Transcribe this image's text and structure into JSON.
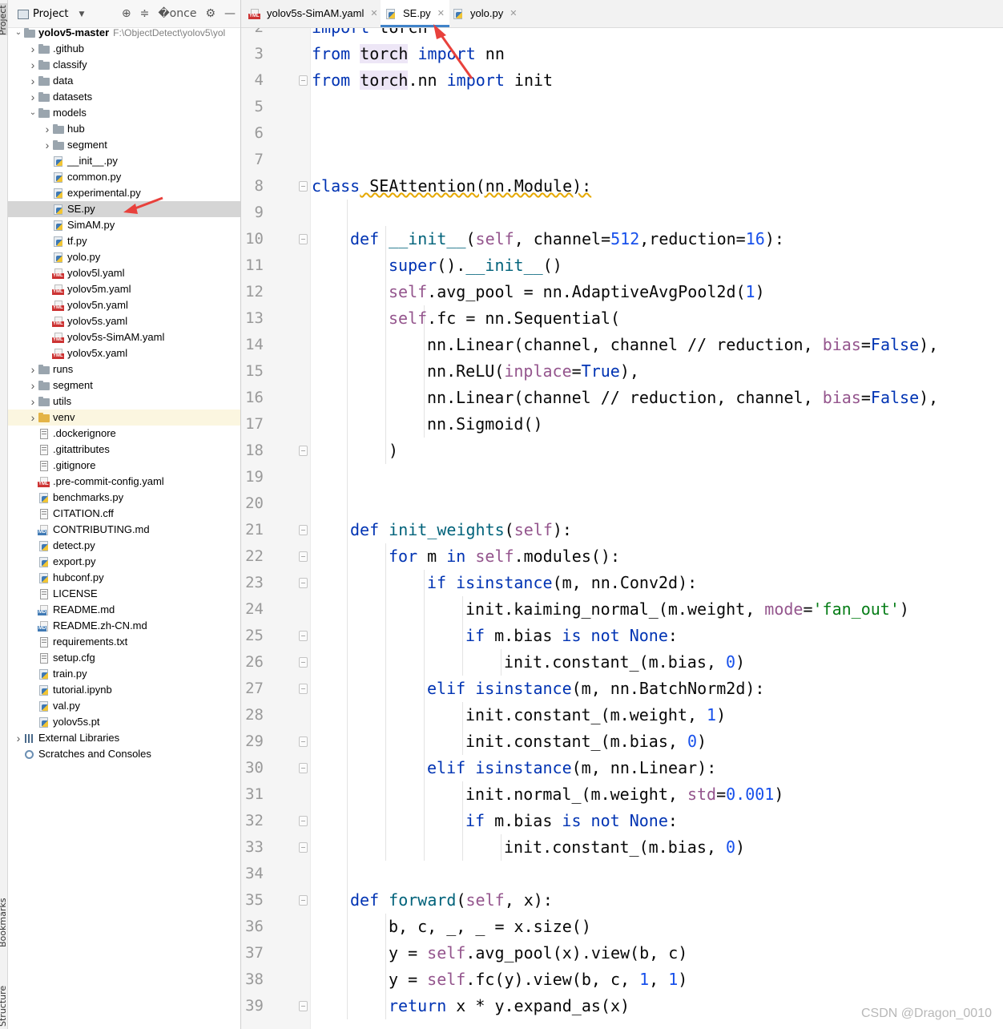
{
  "side_strip": {
    "project_label": "Project",
    "bookmarks_label": "Bookmarks",
    "structure_label": "Structure"
  },
  "project_panel": {
    "title": "Project"
  },
  "tree": [
    {
      "label": "yolov5-master",
      "path": "F:\\ObjectDetect\\yolov5\\yol",
      "type": "root",
      "depth": 0,
      "chev": "open"
    },
    {
      "label": ".github",
      "type": "folder",
      "depth": 1,
      "chev": "closed"
    },
    {
      "label": "classify",
      "type": "folder",
      "depth": 1,
      "chev": "closed"
    },
    {
      "label": "data",
      "type": "folder",
      "depth": 1,
      "chev": "closed"
    },
    {
      "label": "datasets",
      "type": "folder",
      "depth": 1,
      "chev": "closed"
    },
    {
      "label": "models",
      "type": "folder",
      "depth": 1,
      "chev": "open"
    },
    {
      "label": "hub",
      "type": "folder",
      "depth": 2,
      "chev": "closed"
    },
    {
      "label": "segment",
      "type": "folder",
      "depth": 2,
      "chev": "closed"
    },
    {
      "label": "__init__.py",
      "type": "py",
      "depth": 2
    },
    {
      "label": "common.py",
      "type": "py",
      "depth": 2
    },
    {
      "label": "experimental.py",
      "type": "py",
      "depth": 2
    },
    {
      "label": "SE.py",
      "type": "py",
      "depth": 2,
      "selected": true
    },
    {
      "label": "SimAM.py",
      "type": "py",
      "depth": 2
    },
    {
      "label": "tf.py",
      "type": "py",
      "depth": 2
    },
    {
      "label": "yolo.py",
      "type": "py",
      "depth": 2
    },
    {
      "label": "yolov5l.yaml",
      "type": "yml",
      "depth": 2
    },
    {
      "label": "yolov5m.yaml",
      "type": "yml",
      "depth": 2
    },
    {
      "label": "yolov5n.yaml",
      "type": "yml",
      "depth": 2
    },
    {
      "label": "yolov5s.yaml",
      "type": "yml",
      "depth": 2
    },
    {
      "label": "yolov5s-SimAM.yaml",
      "type": "yml",
      "depth": 2
    },
    {
      "label": "yolov5x.yaml",
      "type": "yml",
      "depth": 2
    },
    {
      "label": "runs",
      "type": "folder",
      "depth": 1,
      "chev": "closed"
    },
    {
      "label": "segment",
      "type": "folder",
      "depth": 1,
      "chev": "closed"
    },
    {
      "label": "utils",
      "type": "folder",
      "depth": 1,
      "chev": "closed"
    },
    {
      "label": "venv",
      "type": "folder-orange",
      "depth": 1,
      "chev": "closed",
      "excluded": true
    },
    {
      "label": ".dockerignore",
      "type": "txt",
      "depth": 1
    },
    {
      "label": ".gitattributes",
      "type": "txt",
      "depth": 1
    },
    {
      "label": ".gitignore",
      "type": "txt",
      "depth": 1
    },
    {
      "label": ".pre-commit-config.yaml",
      "type": "yml",
      "depth": 1
    },
    {
      "label": "benchmarks.py",
      "type": "py",
      "depth": 1
    },
    {
      "label": "CITATION.cff",
      "type": "txt",
      "depth": 1
    },
    {
      "label": "CONTRIBUTING.md",
      "type": "md",
      "depth": 1
    },
    {
      "label": "detect.py",
      "type": "py",
      "depth": 1
    },
    {
      "label": "export.py",
      "type": "py",
      "depth": 1
    },
    {
      "label": "hubconf.py",
      "type": "py",
      "depth": 1
    },
    {
      "label": "LICENSE",
      "type": "txt",
      "depth": 1
    },
    {
      "label": "README.md",
      "type": "md",
      "depth": 1
    },
    {
      "label": "README.zh-CN.md",
      "type": "md",
      "depth": 1
    },
    {
      "label": "requirements.txt",
      "type": "txt",
      "depth": 1
    },
    {
      "label": "setup.cfg",
      "type": "txt",
      "depth": 1
    },
    {
      "label": "train.py",
      "type": "py",
      "depth": 1
    },
    {
      "label": "tutorial.ipynb",
      "type": "py",
      "depth": 1
    },
    {
      "label": "val.py",
      "type": "py",
      "depth": 1
    },
    {
      "label": "yolov5s.pt",
      "type": "py",
      "depth": 1
    },
    {
      "label": "External Libraries",
      "type": "lib",
      "depth": 0,
      "chev": "closed"
    },
    {
      "label": "Scratches and Consoles",
      "type": "scratch",
      "depth": 0
    }
  ],
  "tabs": [
    {
      "label": "yolov5s-SimAM.yaml",
      "icon": "yml-file-icon",
      "active": false
    },
    {
      "label": "SE.py",
      "icon": "python-file-icon",
      "active": true
    },
    {
      "label": "yolo.py",
      "icon": "python-file-icon",
      "active": false
    }
  ],
  "code_lines": [
    {
      "n": "2",
      "indent": 0,
      "tokens": [
        [
          "import",
          "kw"
        ],
        [
          " torch",
          ""
        ]
      ],
      "fold": false
    },
    {
      "n": "3",
      "indent": 0,
      "tokens": [
        [
          "from",
          "kw"
        ],
        [
          " ",
          ""
        ],
        [
          "torch",
          "hl"
        ],
        [
          " ",
          ""
        ],
        [
          "import",
          "kw"
        ],
        [
          " nn",
          ""
        ]
      ]
    },
    {
      "n": "4",
      "indent": 0,
      "tokens": [
        [
          "from",
          "kw"
        ],
        [
          " ",
          ""
        ],
        [
          "torch",
          "hl"
        ],
        [
          ".nn ",
          ""
        ],
        [
          "import",
          "kw"
        ],
        [
          " init",
          ""
        ]
      ],
      "fold": true
    },
    {
      "n": "5",
      "indent": 0,
      "tokens": []
    },
    {
      "n": "6",
      "indent": 0,
      "tokens": []
    },
    {
      "n": "7",
      "indent": 0,
      "tokens": []
    },
    {
      "n": "8",
      "indent": 0,
      "tokens": [
        [
          "class",
          "kw"
        ],
        [
          " SEAttention(nn.Module):",
          "err"
        ]
      ],
      "fold": true
    },
    {
      "n": "9",
      "indent": 0,
      "tokens": []
    },
    {
      "n": "10",
      "indent": 1,
      "tokens": [
        [
          "def",
          "kw"
        ],
        [
          " ",
          ""
        ],
        [
          "__init__",
          "fn"
        ],
        [
          "(",
          ""
        ],
        [
          "self",
          "sf"
        ],
        [
          ", channel=",
          ""
        ],
        [
          "512",
          "num"
        ],
        [
          ",reduction=",
          ""
        ],
        [
          "16",
          "num"
        ],
        [
          "):",
          ""
        ]
      ],
      "fold": true
    },
    {
      "n": "11",
      "indent": 2,
      "tokens": [
        [
          "super",
          "kw"
        ],
        [
          "().",
          ""
        ],
        [
          "__init__",
          "fn"
        ],
        [
          "()",
          ""
        ]
      ]
    },
    {
      "n": "12",
      "indent": 2,
      "tokens": [
        [
          "self",
          "sf"
        ],
        [
          ".avg_pool = nn.AdaptiveAvgPool2d(",
          ""
        ],
        [
          "1",
          "num"
        ],
        [
          ")",
          ""
        ]
      ]
    },
    {
      "n": "13",
      "indent": 2,
      "tokens": [
        [
          "self",
          "sf"
        ],
        [
          ".fc = nn.Sequential(",
          ""
        ]
      ]
    },
    {
      "n": "14",
      "indent": 3,
      "tokens": [
        [
          "nn.Linear(channel, channel // reduction, ",
          ""
        ],
        [
          "bias",
          "sf"
        ],
        [
          "=",
          ""
        ],
        [
          "False",
          "kw"
        ],
        [
          "),",
          ""
        ]
      ]
    },
    {
      "n": "15",
      "indent": 3,
      "tokens": [
        [
          "nn.ReLU(",
          ""
        ],
        [
          "inplace",
          "sf"
        ],
        [
          "=",
          ""
        ],
        [
          "True",
          "kw"
        ],
        [
          "),",
          ""
        ]
      ]
    },
    {
      "n": "16",
      "indent": 3,
      "tokens": [
        [
          "nn.Linear(channel // reduction, channel, ",
          ""
        ],
        [
          "bias",
          "sf"
        ],
        [
          "=",
          ""
        ],
        [
          "False",
          "kw"
        ],
        [
          "),",
          ""
        ]
      ]
    },
    {
      "n": "17",
      "indent": 3,
      "tokens": [
        [
          "nn.Sigmoid()",
          ""
        ]
      ]
    },
    {
      "n": "18",
      "indent": 2,
      "tokens": [
        [
          ")",
          ""
        ]
      ],
      "fold": true
    },
    {
      "n": "19",
      "indent": 0,
      "tokens": []
    },
    {
      "n": "20",
      "indent": 0,
      "tokens": []
    },
    {
      "n": "21",
      "indent": 1,
      "tokens": [
        [
          "def",
          "kw"
        ],
        [
          " ",
          ""
        ],
        [
          "init_weights",
          "fn"
        ],
        [
          "(",
          ""
        ],
        [
          "self",
          "sf"
        ],
        [
          "):",
          ""
        ]
      ],
      "fold": true
    },
    {
      "n": "22",
      "indent": 2,
      "tokens": [
        [
          "for",
          "kw"
        ],
        [
          " m ",
          ""
        ],
        [
          "in",
          "kw"
        ],
        [
          " ",
          ""
        ],
        [
          "self",
          "sf"
        ],
        [
          ".modules():",
          ""
        ]
      ],
      "fold": true
    },
    {
      "n": "23",
      "indent": 3,
      "tokens": [
        [
          "if",
          "kw"
        ],
        [
          " ",
          ""
        ],
        [
          "isinstance",
          "kw"
        ],
        [
          "(m, nn.Conv2d):",
          ""
        ]
      ],
      "fold": true
    },
    {
      "n": "24",
      "indent": 4,
      "tokens": [
        [
          "init.kaiming_normal_(m.weight, ",
          ""
        ],
        [
          "mode",
          "sf"
        ],
        [
          "=",
          ""
        ],
        [
          "'fan_out'",
          "str"
        ],
        [
          ")",
          ""
        ]
      ]
    },
    {
      "n": "25",
      "indent": 4,
      "tokens": [
        [
          "if",
          "kw"
        ],
        [
          " m.bias ",
          ""
        ],
        [
          "is not None",
          "kw"
        ],
        [
          ":",
          ""
        ]
      ],
      "fold": true
    },
    {
      "n": "26",
      "indent": 5,
      "tokens": [
        [
          "init.constant_(m.bias, ",
          ""
        ],
        [
          "0",
          "num"
        ],
        [
          ")",
          ""
        ]
      ],
      "fold": true
    },
    {
      "n": "27",
      "indent": 3,
      "tokens": [
        [
          "elif",
          "kw"
        ],
        [
          " ",
          ""
        ],
        [
          "isinstance",
          "kw"
        ],
        [
          "(m, nn.BatchNorm2d):",
          ""
        ]
      ],
      "fold": true
    },
    {
      "n": "28",
      "indent": 4,
      "tokens": [
        [
          "init.constant_(m.weight, ",
          ""
        ],
        [
          "1",
          "num"
        ],
        [
          ")",
          ""
        ]
      ]
    },
    {
      "n": "29",
      "indent": 4,
      "tokens": [
        [
          "init.constant_(m.bias, ",
          ""
        ],
        [
          "0",
          "num"
        ],
        [
          ")",
          ""
        ]
      ],
      "fold": true
    },
    {
      "n": "30",
      "indent": 3,
      "tokens": [
        [
          "elif",
          "kw"
        ],
        [
          " ",
          ""
        ],
        [
          "isinstance",
          "kw"
        ],
        [
          "(m, nn.Linear):",
          ""
        ]
      ],
      "fold": true
    },
    {
      "n": "31",
      "indent": 4,
      "tokens": [
        [
          "init.normal_(m.weight, ",
          ""
        ],
        [
          "std",
          "sf"
        ],
        [
          "=",
          ""
        ],
        [
          "0.001",
          "num"
        ],
        [
          ")",
          ""
        ]
      ]
    },
    {
      "n": "32",
      "indent": 4,
      "tokens": [
        [
          "if",
          "kw"
        ],
        [
          " m.bias ",
          ""
        ],
        [
          "is not None",
          "kw"
        ],
        [
          ":",
          ""
        ]
      ],
      "fold": true
    },
    {
      "n": "33",
      "indent": 5,
      "tokens": [
        [
          "init.constant_(m.bias, ",
          ""
        ],
        [
          "0",
          "num"
        ],
        [
          ")",
          ""
        ]
      ],
      "fold": true
    },
    {
      "n": "34",
      "indent": 0,
      "tokens": []
    },
    {
      "n": "35",
      "indent": 1,
      "tokens": [
        [
          "def",
          "kw"
        ],
        [
          " ",
          ""
        ],
        [
          "forward",
          "fn"
        ],
        [
          "(",
          ""
        ],
        [
          "self",
          "sf"
        ],
        [
          ", x):",
          ""
        ]
      ],
      "fold": true
    },
    {
      "n": "36",
      "indent": 2,
      "tokens": [
        [
          "b, c, _, _ = x.size()",
          ""
        ]
      ]
    },
    {
      "n": "37",
      "indent": 2,
      "tokens": [
        [
          "y = ",
          ""
        ],
        [
          "self",
          "sf"
        ],
        [
          ".avg_pool(x).view(b, c)",
          ""
        ]
      ]
    },
    {
      "n": "38",
      "indent": 2,
      "tokens": [
        [
          "y = ",
          ""
        ],
        [
          "self",
          "sf"
        ],
        [
          ".fc(y).view(b, c, ",
          ""
        ],
        [
          "1",
          "num"
        ],
        [
          ", ",
          ""
        ],
        [
          "1",
          "num"
        ],
        [
          ")",
          ""
        ]
      ]
    },
    {
      "n": "39",
      "indent": 2,
      "tokens": [
        [
          "return",
          "kw"
        ],
        [
          " x * y.expand_as(x)",
          ""
        ]
      ],
      "fold": true
    }
  ],
  "watermark": "CSDN @Dragon_0010",
  "colors": {
    "keyword": "#0033b3",
    "function": "#00627a",
    "self": "#94558d",
    "number": "#1750eb",
    "string": "#067d17",
    "annotation_arrow": "#e8413c",
    "tab_accent": "#4083c9"
  }
}
